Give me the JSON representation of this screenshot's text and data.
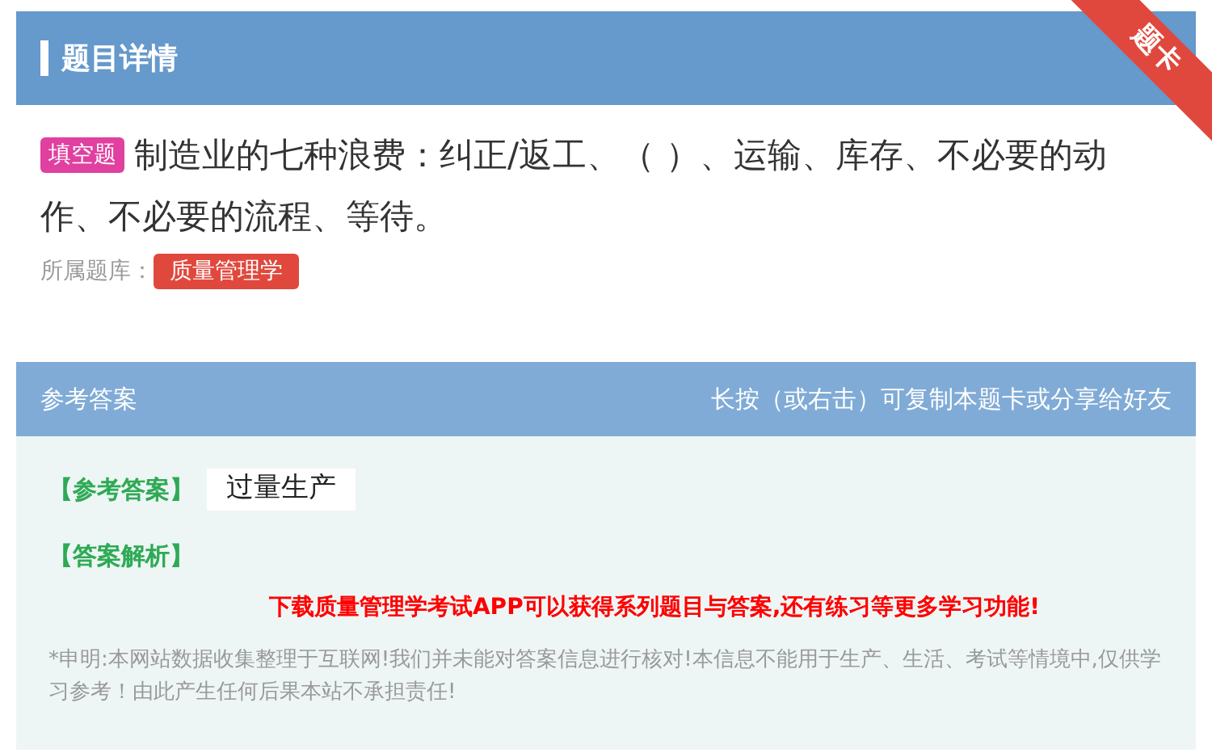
{
  "header": {
    "title": "题目详情",
    "ribbon": "题卡"
  },
  "question": {
    "type_tag": "填空题",
    "text": "制造业的七种浪费：纠正/返工、（ ）、运输、库存、不必要的动作、不必要的流程、等待。",
    "bank_label": "所属题库：",
    "bank_tag": "质量管理学"
  },
  "answer_panel": {
    "title": "参考答案",
    "hint": "长按（或右击）可复制本题卡或分享给好友",
    "answer_label": "【参考答案】",
    "answer": "过量生产",
    "analysis_label": "【答案解析】",
    "promo": "下载质量管理学考试APP可以获得系列题目与答案,还有练习等更多学习功能!",
    "disclaimer": "*申明:本网站数据收集整理于互联网!我们并未能对答案信息进行核对!本信息不能用于生产、生活、考试等情境中,仅供学习参考！由此产生任何后果本站不承担责任!"
  }
}
